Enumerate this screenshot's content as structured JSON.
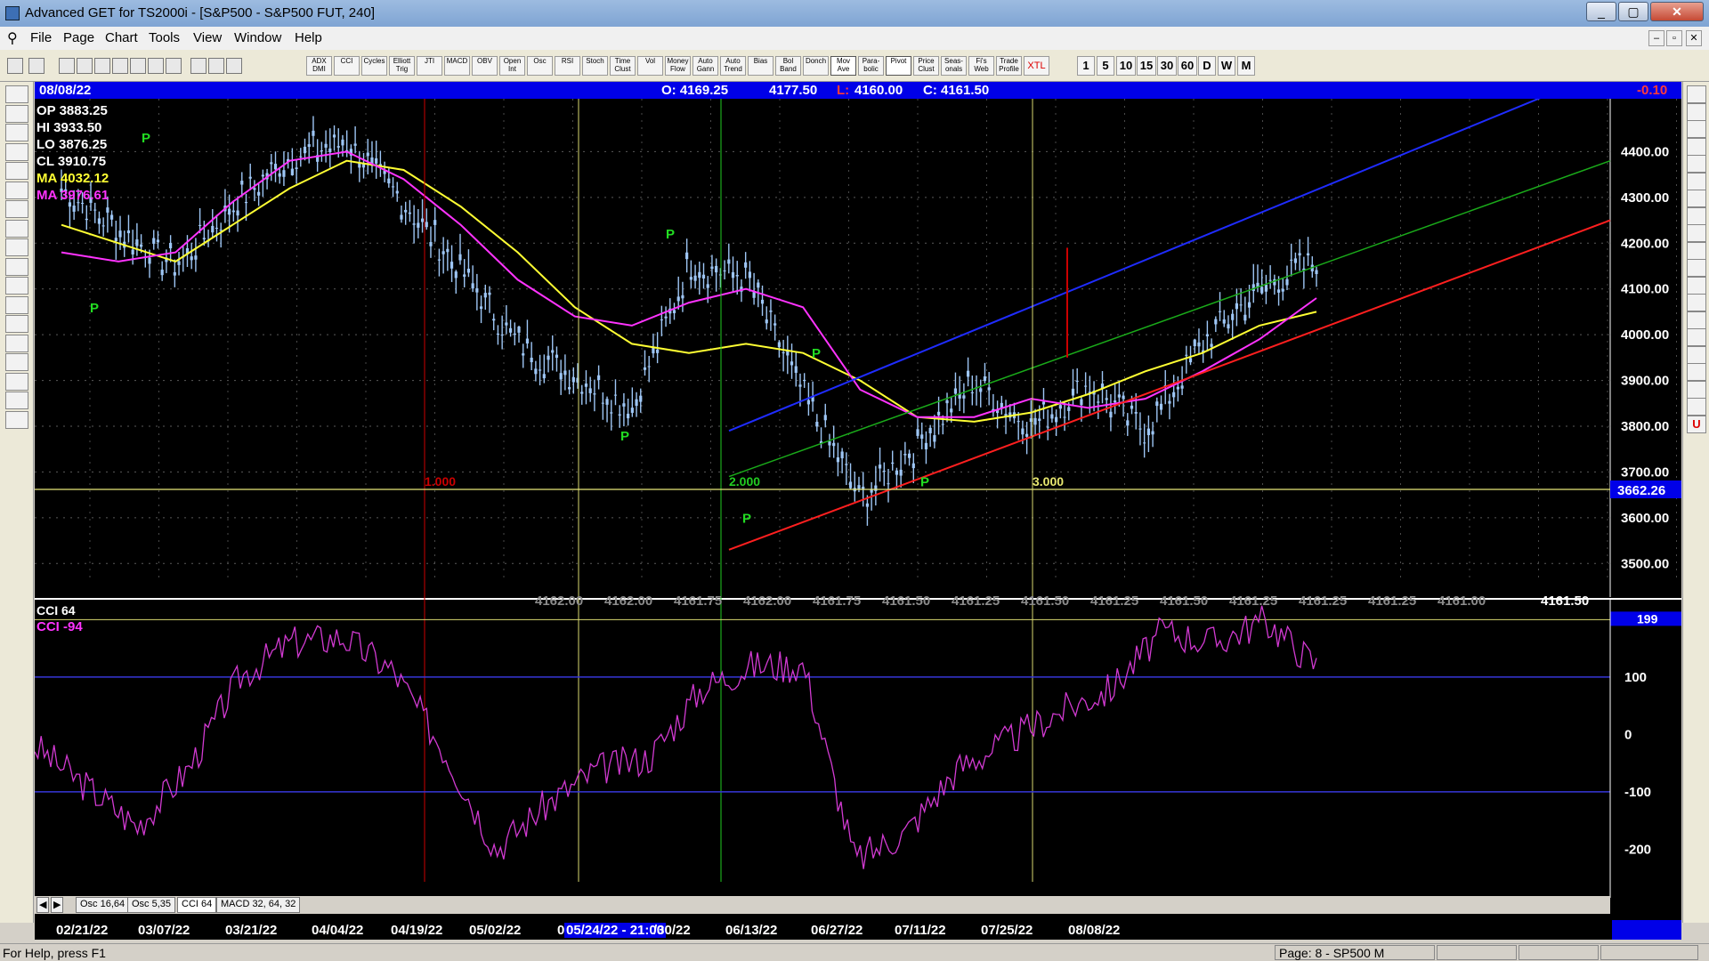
{
  "window": {
    "title": "Advanced GET for TS2000i - [S&P500 - S&P500 FUT, 240]",
    "min_glyph": "_",
    "max_glyph": "▢",
    "close_glyph": "✕"
  },
  "menu": [
    "File",
    "Page",
    "Chart",
    "Tools",
    "View",
    "Window",
    "Help"
  ],
  "toolbar": {
    "indicator_buttons": [
      "ADX DMI",
      "CCI",
      "Cycles",
      "Elliott Trig",
      "JTI",
      "MACD",
      "OBV",
      "Open Int",
      "Osc",
      "RSI",
      "Stoch",
      "Time Clust",
      "Vol",
      "Money Flow",
      "Auto Gann",
      "Auto Trend",
      "Bias",
      "Bol Band",
      "Donch",
      "Mov Ave",
      "Para- bolic",
      "Pivot",
      "Price Clust",
      "Seas- onals",
      "Fi's Web",
      "Trade Profile",
      "XTL"
    ],
    "active_buttons": [
      "Mov Ave",
      "Pivot"
    ],
    "interval_buttons": [
      "1",
      "5",
      "10",
      "15",
      "30",
      "60",
      "D",
      "W",
      "M"
    ]
  },
  "infobar": {
    "date": "08/08/22",
    "open": "O: 4169.25",
    "high": "4177.50",
    "low_label": "L:",
    "low": "4160.00",
    "close": "C: 4161.50",
    "change": "-0.10"
  },
  "legend": {
    "op": "OP  3883.25",
    "hi": "HI   3933.50",
    "lo": "LO  3876.25",
    "cl": "CL  3910.75",
    "ma1": "MA  4032.12",
    "ma2": "MA  3976.61"
  },
  "colors": {
    "ma1": "#ffff33",
    "ma2": "#ff33ff",
    "bars": "#9ec6f5",
    "upper_channel": "#1f2cff",
    "mid_channel": "#1aaa1a",
    "lower_channel": "#ff1f1f",
    "price_highlight": "#0000e8",
    "pivot_label": "#22dd22"
  },
  "price_axis": {
    "ticks": [
      "4400.00",
      "4300.00",
      "4200.00",
      "4100.00",
      "4000.00",
      "3900.00",
      "3800.00",
      "3700.00",
      "3600.00",
      "3500.00"
    ],
    "highlight": "3662.26"
  },
  "time_cycle_labels": [
    "1.000",
    "2.000",
    "3.000"
  ],
  "pivot_marker": "P",
  "bottom_prices": [
    "4162.00",
    "4162.00",
    "4161.75",
    "4162.00",
    "4161.75",
    "4161.50",
    "4161.25",
    "4161.50",
    "4161.25",
    "4161.50",
    "4161.25",
    "4161.25",
    "4161.25",
    "4161.00"
  ],
  "last_price": "4161.50",
  "cci": {
    "title": "CCI 64",
    "value_label": "CCI  -94",
    "current": "199",
    "ticks": [
      "100",
      "0",
      "-100",
      "-200"
    ]
  },
  "tabs": [
    "Osc 16,64",
    "Osc 5,35",
    "CCI 64",
    "MACD 32, 64, 32"
  ],
  "active_tab": "CCI 64",
  "dates": [
    "02/21/22",
    "03/07/22",
    "03/21/22",
    "04/04/22",
    "04/19/22",
    "05/02/22",
    "05/24/22 - 21:00",
    "/30/22",
    "06/13/22",
    "06/27/22",
    "07/11/22",
    "07/25/22",
    "08/08/22"
  ],
  "date_cursor_prefix": "0",
  "status": {
    "help": "For Help, press F1",
    "page": "Page: 8 - SP500 M"
  },
  "chart_data": {
    "type": "candlestick",
    "title": "S&P500 FUT, 240",
    "y_range": [
      3450,
      4500
    ],
    "series": [
      {
        "name": "MA",
        "values_approx": [
          4240,
          4200,
          4160,
          4240,
          4320,
          4380,
          4360,
          4280,
          4180,
          4060,
          3980,
          3960,
          3980,
          3960,
          3900,
          3820,
          3810,
          3830,
          3870,
          3920,
          3960,
          4020,
          4050
        ]
      },
      {
        "name": "MA",
        "values_approx": [
          4180,
          4160,
          4180,
          4290,
          4380,
          4400,
          4340,
          4240,
          4120,
          4040,
          4020,
          4070,
          4100,
          4060,
          3880,
          3820,
          3820,
          3860,
          3840,
          3860,
          3920,
          3990,
          4080
        ]
      }
    ],
    "close_approx": [
      4320,
      4230,
      4150,
      4280,
      4390,
      4420,
      4290,
      4140,
      3980,
      3910,
      3840,
      4150,
      4130,
      3870,
      3640,
      3760,
      3900,
      3800,
      3890,
      3790,
      3980,
      4100,
      4161.5
    ],
    "cci_approx": [
      -20,
      -90,
      -160,
      -60,
      100,
      160,
      170,
      110,
      -30,
      -200,
      -120,
      -60,
      -40,
      80,
      120,
      120,
      -220,
      -170,
      -60,
      -10,
      40,
      80,
      180,
      160,
      199,
      120
    ]
  }
}
